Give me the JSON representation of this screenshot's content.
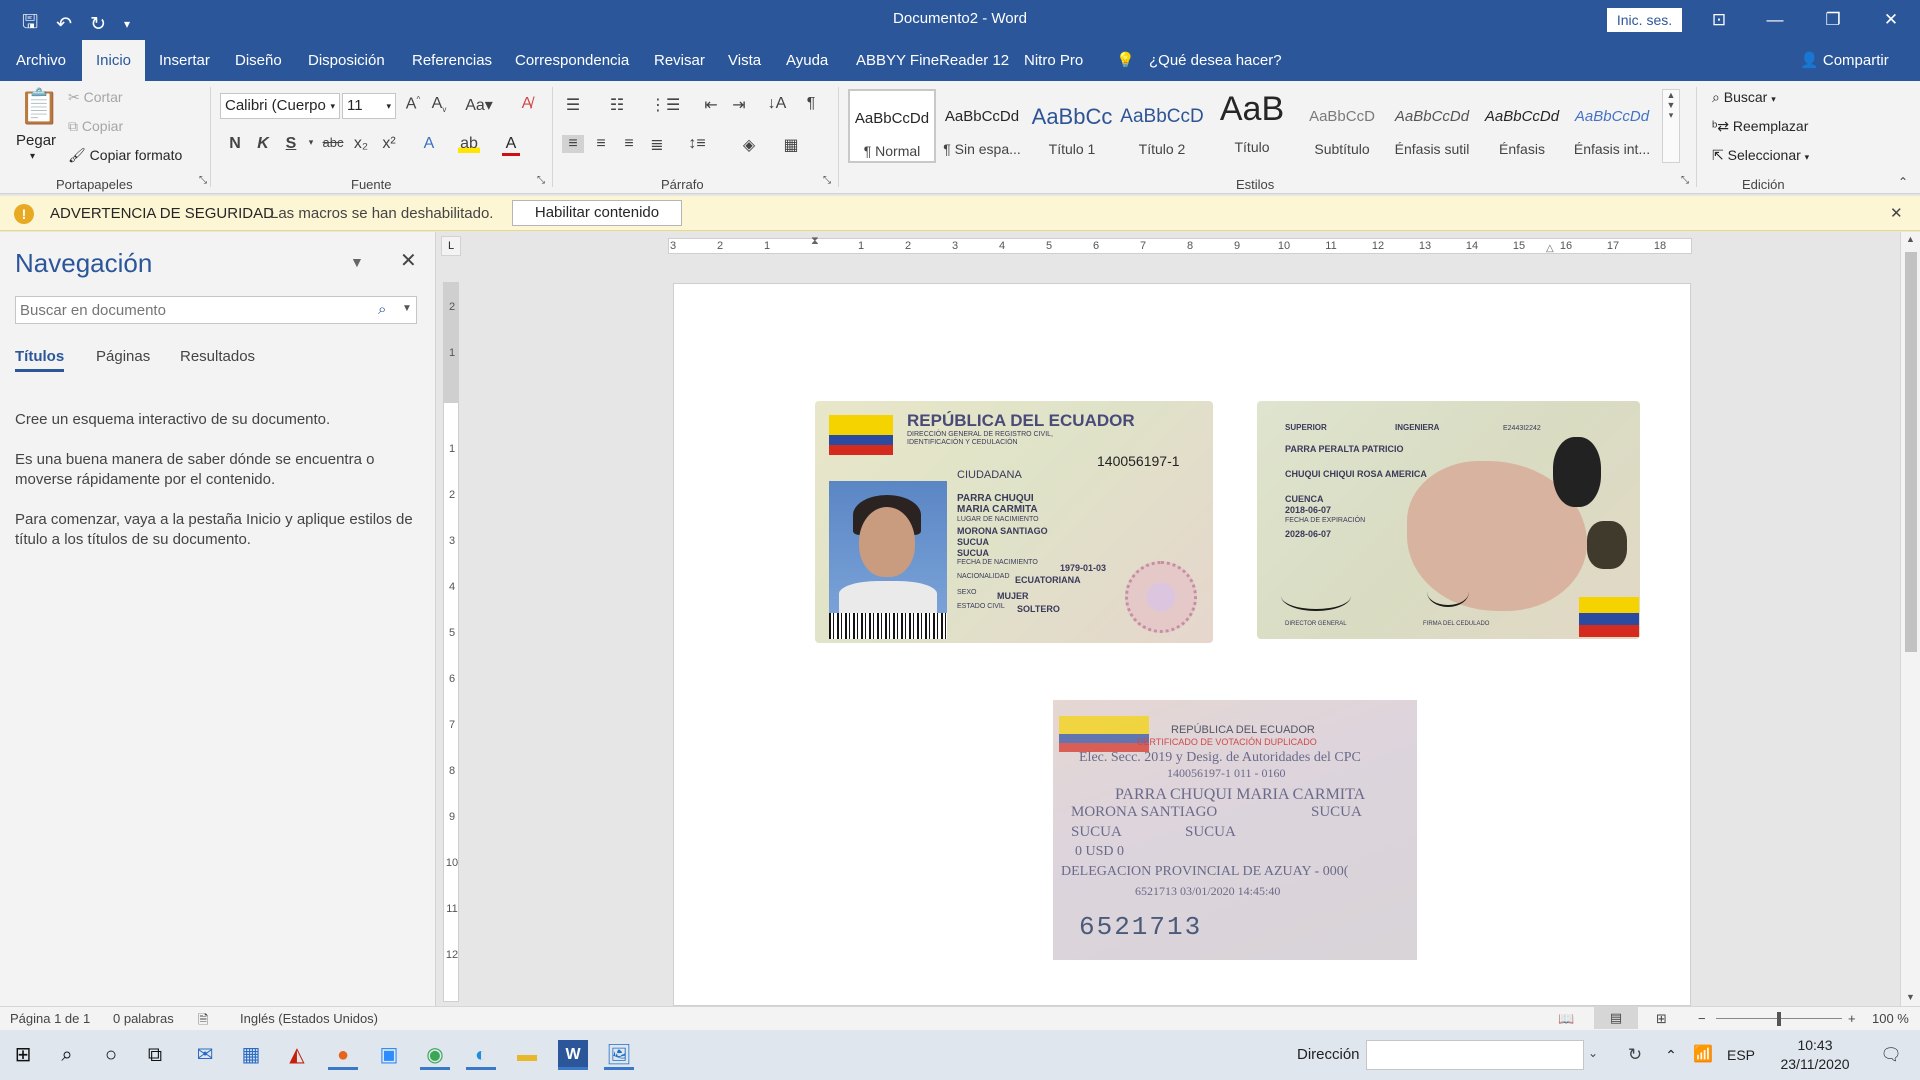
{
  "window": {
    "title": "Documento2 - Word",
    "signin": "Inic. ses."
  },
  "tabs": [
    "Archivo",
    "Inicio",
    "Insertar",
    "Diseño",
    "Disposición",
    "Referencias",
    "Correspondencia",
    "Revisar",
    "Vista",
    "Ayuda",
    "ABBYY FineReader 12",
    "Nitro Pro",
    "¿Qué desea hacer?"
  ],
  "share": "Compartir",
  "ribbon": {
    "clipboard": {
      "paste": "Pegar",
      "cut": "Cortar",
      "copy": "Copiar",
      "format_painter": "Copiar formato",
      "label": "Portapapeles"
    },
    "font": {
      "name": "Calibri (Cuerpo",
      "size": "11",
      "label": "Fuente"
    },
    "paragraph": {
      "label": "Párrafo"
    },
    "styles": {
      "label": "Estilos",
      "items": [
        {
          "preview": "AaBbCcDd",
          "name": "¶ Normal"
        },
        {
          "preview": "AaBbCcDd",
          "name": "¶ Sin espa..."
        },
        {
          "preview": "AaBbCc",
          "name": "Título 1"
        },
        {
          "preview": "AaBbCcD",
          "name": "Título 2"
        },
        {
          "preview": "AaB",
          "name": "Título"
        },
        {
          "preview": "AaBbCcD",
          "name": "Subtítulo"
        },
        {
          "preview": "AaBbCcDd",
          "name": "Énfasis sutil"
        },
        {
          "preview": "AaBbCcDd",
          "name": "Énfasis"
        },
        {
          "preview": "AaBbCcDd",
          "name": "Énfasis int..."
        }
      ]
    },
    "editing": {
      "find": "Buscar",
      "replace": "Reemplazar",
      "select": "Seleccionar",
      "label": "Edición"
    }
  },
  "security": {
    "title": "ADVERTENCIA DE SEGURIDAD",
    "message": "Las macros se han deshabilitado.",
    "button": "Habilitar contenido"
  },
  "nav": {
    "title": "Navegación",
    "search_placeholder": "Buscar en documento",
    "tabs": [
      "Títulos",
      "Páginas",
      "Resultados"
    ],
    "p1": "Cree un esquema interactivo de su documento.",
    "p2": "Es una buena manera de saber dónde se encuentra o moverse rápidamente por el contenido.",
    "p3": "Para comenzar, vaya a la pestaña Inicio y aplique estilos de título a los títulos de su documento."
  },
  "ruler_h": [
    "3",
    "2",
    "1",
    "1",
    "2",
    "3",
    "4",
    "5",
    "6",
    "7",
    "8",
    "9",
    "10",
    "11",
    "12",
    "13",
    "14",
    "15",
    "16",
    "17",
    "18"
  ],
  "ruler_v": [
    "2",
    "1",
    "1",
    "2",
    "3",
    "4",
    "5",
    "6",
    "7",
    "8",
    "9",
    "10",
    "11",
    "12"
  ],
  "card1": {
    "country": "REPÚBLICA DEL ECUADOR",
    "agency": "DIRECCIÓN GENERAL DE REGISTRO CIVIL, IDENTIFICACIÓN Y CEDULACIÓN",
    "number": "140056197-1",
    "type": "CIUDADANA",
    "surname1": "PARRA CHUQUI",
    "given": "MARIA CARMITA",
    "birthplace_label": "LUGAR DE NACIMIENTO",
    "birthplace1": "MORONA SANTIAGO",
    "birthplace2": "SUCUA",
    "birthplace3": "SUCUA",
    "dob_label": "FECHA DE NACIMIENTO",
    "dob": "1979-01-03",
    "nationality_label": "NACIONALIDAD",
    "nationality": "ECUATORIANA",
    "sex_label": "SEXO",
    "sex": "MUJER",
    "civil_label": "ESTADO CIVIL",
    "civil": "SOLTERO"
  },
  "card2": {
    "instruction": "SUPERIOR",
    "profession": "INGENIERA",
    "code": "E2443I2242",
    "father": "PARRA PERALTA PATRICIO",
    "mother": "CHUQUI CHIQUI ROSA AMERICA",
    "place": "CUENCA",
    "issue": "2018-06-07",
    "expiry_label": "FECHA DE EXPIRACIÓN",
    "expiry": "2028-06-07",
    "director": "DIRECTOR GENERAL",
    "holder": "FIRMA DEL CEDULADO"
  },
  "card3": {
    "country": "REPÚBLICA DEL ECUADOR",
    "cert": "CERTIFICADO DE VOTACIÓN DUPLICADO",
    "election": "Elec. Secc. 2019 y Desig. de Autoridades del CPC",
    "id": "140056197-1   011 - 0160",
    "name": "PARRA CHUQUI MARIA CARMITA",
    "prov": "MORONA SANTIAGO",
    "canton": "SUCUA",
    "parish": "SUCUA",
    "zone": "SUCUA",
    "usd": "0   USD 0",
    "delegation": "DELEGACION PROVINCIAL DE AZUAY - 000(",
    "serial_time": "6521713       03/01/2020 14:45:40",
    "serial": "6521713"
  },
  "status": {
    "page": "Página 1 de 1",
    "words": "0 palabras",
    "lang": "Inglés (Estados Unidos)",
    "zoom": "100 %"
  },
  "taskbar": {
    "dir_label": "Dirección",
    "lang": "ESP",
    "time": "10:43",
    "date": "23/11/2020"
  }
}
